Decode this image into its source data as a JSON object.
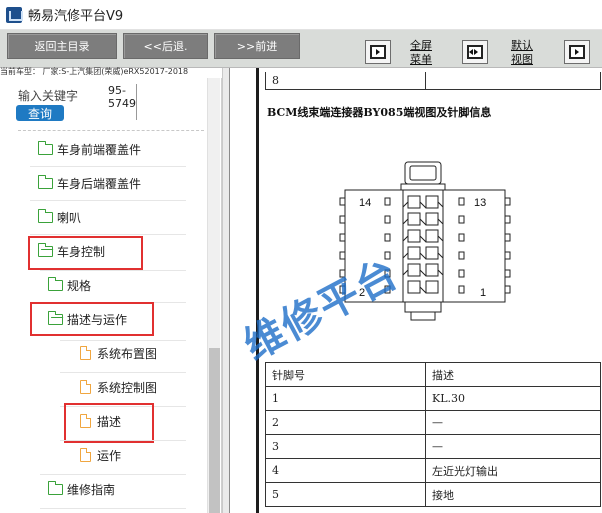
{
  "window": {
    "title": "畅易汽修平台V9",
    "icon": "app-logo-icon"
  },
  "toolbar": {
    "home_label": "返回主目录",
    "back_label": "<<后退.",
    "forward_label": ">>前进",
    "fullscreen_label_1": "全屏",
    "fullscreen_label_2": "菜单",
    "default_label_1": "默认",
    "default_label_2": "视图"
  },
  "current_model": "当前车型： 厂家:S-上汽集团(荣威)eRX52017-2018",
  "search": {
    "label": "输入关键字",
    "value": "95-5749",
    "button": "查询"
  },
  "tree": [
    {
      "label": "车身前端覆盖件",
      "type": "folder"
    },
    {
      "label": "车身后端覆盖件",
      "type": "folder"
    },
    {
      "label": "喇叭",
      "type": "folder"
    },
    {
      "label": "车身控制",
      "type": "folder-open"
    },
    {
      "label": "规格",
      "type": "folder"
    },
    {
      "label": "描述与运作",
      "type": "folder-open"
    },
    {
      "label": "系统布置图",
      "type": "document"
    },
    {
      "label": "系统控制图",
      "type": "document"
    },
    {
      "label": "描述",
      "type": "document"
    },
    {
      "label": "运作",
      "type": "document"
    },
    {
      "label": "维修指南",
      "type": "folder"
    }
  ],
  "document": {
    "prev_row_num": "8",
    "heading": "BCM线束端连接器BY085端视图及针脚信息",
    "connector": {
      "label_top_left": "14",
      "label_top_right": "13",
      "label_bottom_left": "2",
      "label_bottom_right": "1"
    },
    "table_headers": [
      "针脚号",
      "描述"
    ],
    "table_rows": [
      [
        "1",
        "KL.30"
      ],
      [
        "2",
        "—"
      ],
      [
        "3",
        "—"
      ],
      [
        "4",
        "左近光灯输出"
      ],
      [
        "5",
        "接地"
      ]
    ]
  },
  "watermark": "维修平台",
  "colors": {
    "toolbar_button": "#7d7d7d",
    "query_button": "#1f7ac3",
    "highlight": "#e13030",
    "folder": "#3aa23a",
    "document": "#f0a640"
  }
}
